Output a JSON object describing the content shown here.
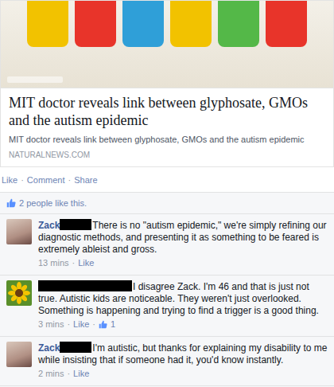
{
  "article": {
    "title": "MIT doctor reveals link between glyphosate, GMOs and the autism epidemic",
    "description": "MIT doctor reveals link between glyphosate, GMOs and the autism epidemic",
    "domain": "NATURALNEWS.COM"
  },
  "separator": "·",
  "actions": [
    "Like",
    "Comment",
    "Share"
  ],
  "likes": {
    "text": "2 people like this."
  },
  "comments": [
    {
      "kind": "person",
      "author": "Zack",
      "redacted": true,
      "redaction": "short",
      "text": "There is no \"autism epidemic,\" we're simply refining our diagnostic methods, and presenting it as something to be feared is extremely ableist and gross.",
      "time": "13 mins",
      "actions": [
        "Like"
      ],
      "like_count": ""
    },
    {
      "kind": "flower",
      "author": "",
      "redacted": true,
      "redaction": "long",
      "text": "I disagree Zack. I'm 46 and that is just not true. Autistic kids are noticeable. They weren't just overlooked. Something is happening and trying to find a trigger is a good thing.",
      "time": "3 mins",
      "actions": [
        "Like"
      ],
      "like_count": "1"
    },
    {
      "kind": "person",
      "author": "Zack",
      "redacted": true,
      "redaction": "short",
      "text": "I'm autistic, but thanks for explaining my disability to me while insisting that if someone had it, you'd know instantly.",
      "time": "2 mins",
      "actions": [
        "Like"
      ],
      "like_count": ""
    }
  ]
}
